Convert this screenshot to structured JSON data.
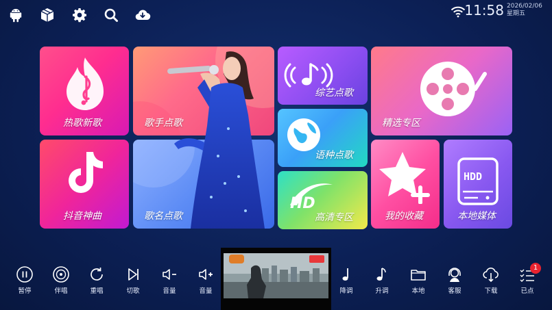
{
  "status": {
    "time": "11:58",
    "date": "2026/02/06",
    "weekday": "星期五"
  },
  "topbar_icons": [
    "android-icon",
    "box-icon",
    "gear-icon",
    "search-icon",
    "cloud-download-icon"
  ],
  "tiles": {
    "hot": "热歌新歌",
    "singer": "歌手点歌",
    "variety": "综艺点歌",
    "language": "语种点歌",
    "album": "精选专区",
    "douyin": "抖音神曲",
    "song_name": "歌名点歌",
    "hd": "高清专区",
    "favorites": "我的收藏",
    "local_media": "本地媒体",
    "hdd_text": "HDD"
  },
  "video": {
    "badge_left": "",
    "badge_right": ""
  },
  "bottom": {
    "pause": "暂停",
    "accompany": "伴唱",
    "replay": "重唱",
    "next": "切歌",
    "vol_down": "音量",
    "vol_up": "音量",
    "key_down": "降调",
    "key_up": "升调",
    "local": "本地",
    "service": "客服",
    "download": "下载",
    "selected": "已点",
    "selected_count": "1"
  }
}
